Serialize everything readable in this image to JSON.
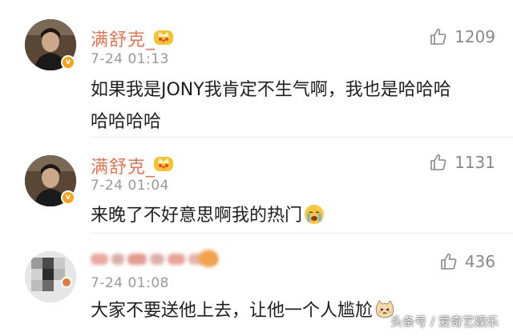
{
  "comments": [
    {
      "username": "满舒克_",
      "timestamp": "7-24 01:13",
      "likes": "1209",
      "text": "如果我是JONY我肯定不生气啊，我也是哈哈哈哈哈哈哈",
      "text_line1": "如果我是JONY我肯定不生气啊，我也是哈哈哈",
      "text_line2": "哈哈哈哈",
      "verified": true,
      "badge": "crown-badge-icon"
    },
    {
      "username": "满舒克_",
      "timestamp": "7-24 01:04",
      "likes": "1131",
      "text": "来晚了不好意思啊我的热门",
      "emoji": "crying-face-emoji",
      "verified": true,
      "badge": "crown-badge-icon"
    },
    {
      "username": "",
      "username_blurred": true,
      "timestamp": "7-24 01:08",
      "likes": "436",
      "text": "大家不要送他上去，让他一个人尴尬",
      "emoji": "cat-face-emoji",
      "verified": true
    }
  ],
  "watermark": {
    "text": "头条号 / 爱奇艺娱乐"
  },
  "colors": {
    "username": "#eb7350",
    "timestamp": "#999999",
    "like": "#888888",
    "verified_badge": "#f7a21b"
  }
}
